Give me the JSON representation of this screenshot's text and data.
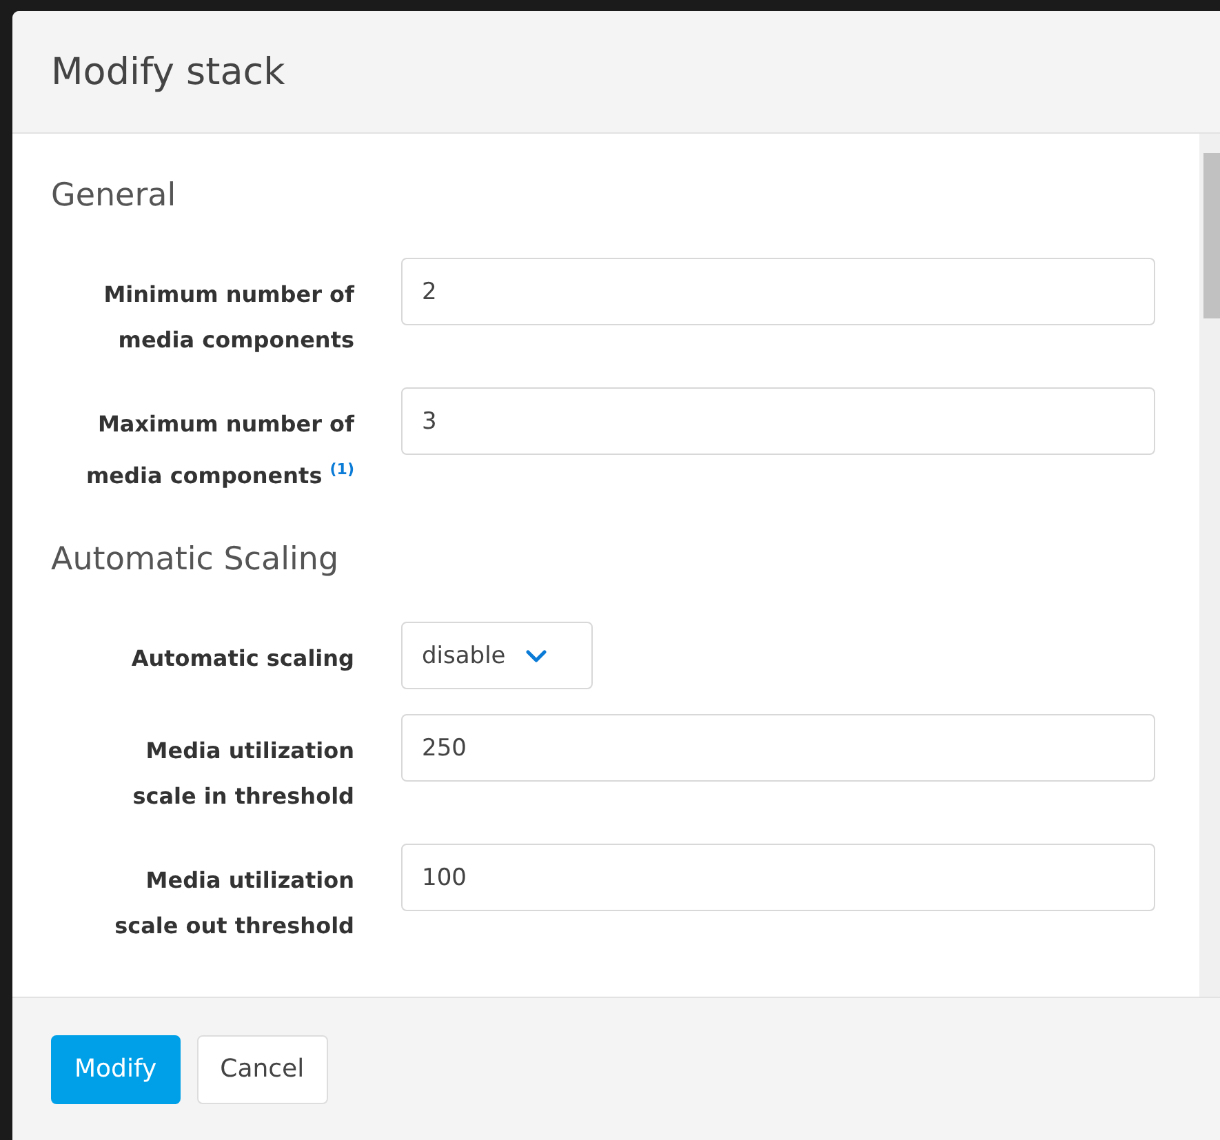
{
  "dialog": {
    "title": "Modify stack",
    "sections": [
      {
        "heading": "General",
        "fields": [
          {
            "kind": "input",
            "label": "Minimum number of media components",
            "value": "2"
          },
          {
            "kind": "input",
            "label": "Maximum number of media components $^{(1)}$",
            "value": "3"
          }
        ]
      },
      {
        "heading": "Automatic Scaling",
        "fields": [
          {
            "kind": "select",
            "label": "Automatic scaling",
            "value": "disable"
          },
          {
            "kind": "input",
            "label": "Media utilization scale in threshold",
            "value": "250"
          },
          {
            "kind": "input",
            "label": "Media utilization scale out threshold",
            "value": "100"
          }
        ]
      }
    ],
    "buttons": [
      {
        "label": "Modify",
        "kind": "primary"
      },
      {
        "label": "Cancel",
        "kind": "secondary"
      }
    ]
  }
}
